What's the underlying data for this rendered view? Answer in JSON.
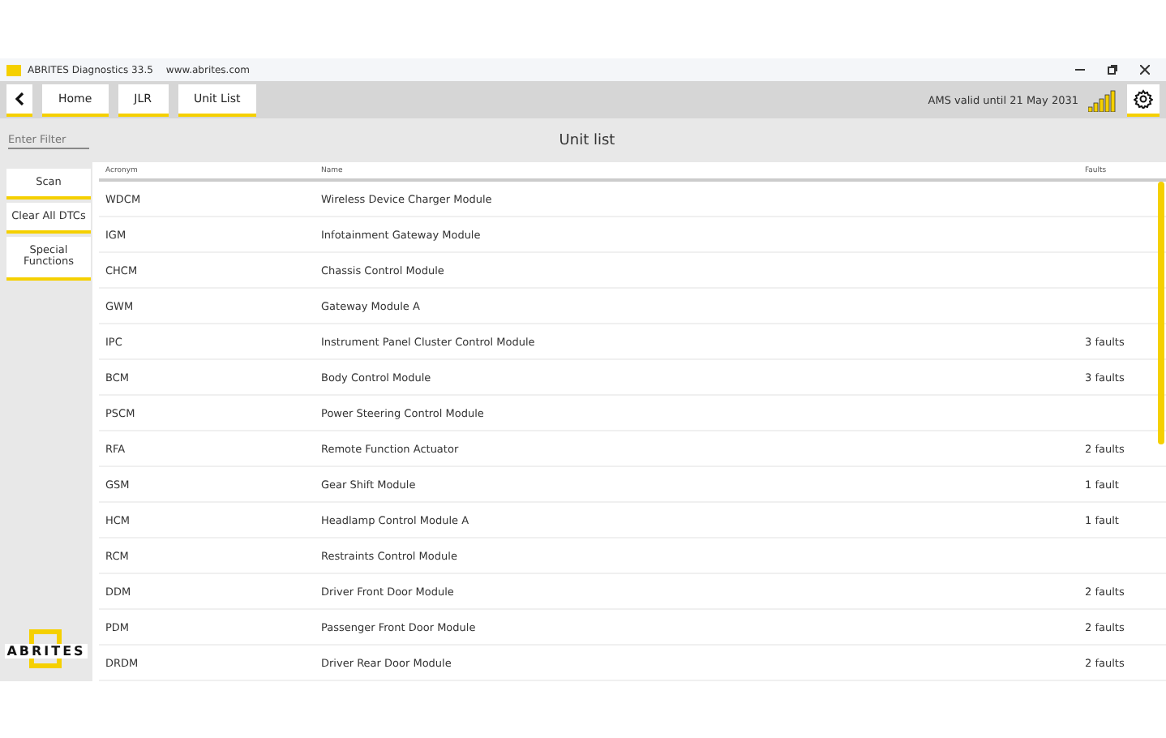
{
  "window": {
    "title": "ABRITES Diagnostics 33.5",
    "url": "www.abrites.com"
  },
  "breadcrumbs": [
    {
      "label": "Home"
    },
    {
      "label": "JLR"
    },
    {
      "label": "Unit List"
    }
  ],
  "license": "AMS valid until 21 May 2031",
  "filter": {
    "placeholder": "Enter Filter"
  },
  "page_title": "Unit list",
  "actions": [
    {
      "label": "Scan"
    },
    {
      "label": "Clear All DTCs"
    },
    {
      "label": "Special Functions"
    }
  ],
  "logo": "ABRITES",
  "table": {
    "columns": [
      "Acronym",
      "Name",
      "Faults"
    ],
    "rows": [
      {
        "acronym": "WDCM",
        "name": "Wireless Device Charger Module",
        "faults": ""
      },
      {
        "acronym": "IGM",
        "name": "Infotainment Gateway Module",
        "faults": ""
      },
      {
        "acronym": "CHCM",
        "name": "Chassis Control Module",
        "faults": ""
      },
      {
        "acronym": "GWM",
        "name": "Gateway Module A",
        "faults": ""
      },
      {
        "acronym": "IPC",
        "name": "Instrument Panel Cluster Control Module",
        "faults": "3 faults"
      },
      {
        "acronym": "BCM",
        "name": "Body Control Module",
        "faults": "3 faults"
      },
      {
        "acronym": "PSCM",
        "name": "Power Steering Control Module",
        "faults": ""
      },
      {
        "acronym": "RFA",
        "name": "Remote Function Actuator",
        "faults": "2 faults"
      },
      {
        "acronym": "GSM",
        "name": "Gear Shift Module",
        "faults": "1 fault"
      },
      {
        "acronym": "HCM",
        "name": "Headlamp Control Module A",
        "faults": "1 fault"
      },
      {
        "acronym": "RCM",
        "name": "Restraints Control Module",
        "faults": ""
      },
      {
        "acronym": "DDM",
        "name": "Driver Front Door Module",
        "faults": "2 faults"
      },
      {
        "acronym": "PDM",
        "name": "Passenger Front Door Module",
        "faults": "2 faults"
      },
      {
        "acronym": "DRDM",
        "name": "Driver Rear Door Module",
        "faults": "2 faults"
      }
    ]
  }
}
